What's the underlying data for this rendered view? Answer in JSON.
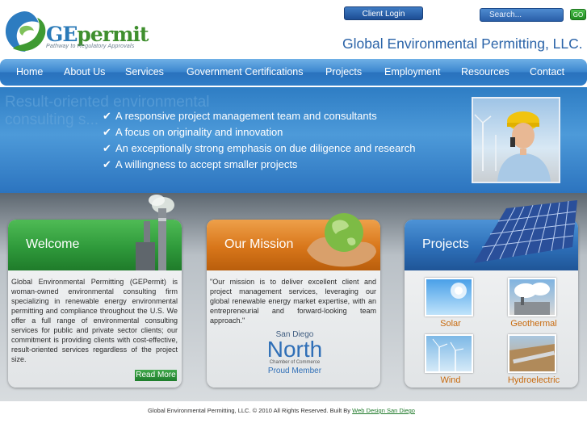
{
  "header": {
    "logo_ge": "GE",
    "logo_permit": "permit",
    "tagline": "Pathway to Regulatory Approvals",
    "client_login": "Client Login",
    "search_placeholder": "Search...",
    "go_label": "GO",
    "site_title": "Global Environmental Permitting, LLC."
  },
  "nav": [
    "Home",
    "About Us",
    "Services",
    "Government Certifications",
    "Projects",
    "Employment",
    "Resources",
    "Contact"
  ],
  "banner": {
    "ghost_line1": "Result-oriented environmental",
    "ghost_line2": "consulting s...",
    "bullets": [
      "A responsive project management team and consultants",
      "A focus on originality and innovation",
      "An exceptionally strong emphasis on due diligence and research",
      "A willingness to accept smaller projects"
    ]
  },
  "welcome": {
    "title": "Welcome",
    "body": "Global Environmental Permitting (GEPermit) is woman-owned environmental consulting firm specializing in renewable energy environmental permitting and compliance throughout the U.S. We offer a full range of environmental consulting services for public and private sector clients; our commitment is providing clients with cost-effective, result-oriented services regardless of the project size.",
    "read_more": "Read More"
  },
  "mission": {
    "title": "Our Mission",
    "body": "\"Our mission is to deliver excellent client and project management services, leveraging our global renewable energy market expertise, with an entrepreneurial and forward-looking team approach.\"",
    "badge_line1": "San Diego",
    "badge_line2": "North",
    "badge_line3": "Chamber of Commerce",
    "badge_line4": "Proud Member"
  },
  "projects": {
    "title": "Projects",
    "items": [
      "Solar",
      "Geothermal",
      "Wind",
      "Hydroelectric"
    ]
  },
  "footer": {
    "copyright": "Global Environmental Permitting, LLC. © 2010 All Rights Reserved. Built By",
    "link": "Web Design San Diego"
  },
  "colors": {
    "nav_blue": "#3c87cf",
    "welcome_green": "#2f9a3b",
    "mission_orange": "#d8761a",
    "projects_blue": "#2d6fb8",
    "project_label": "#c86a0e"
  }
}
